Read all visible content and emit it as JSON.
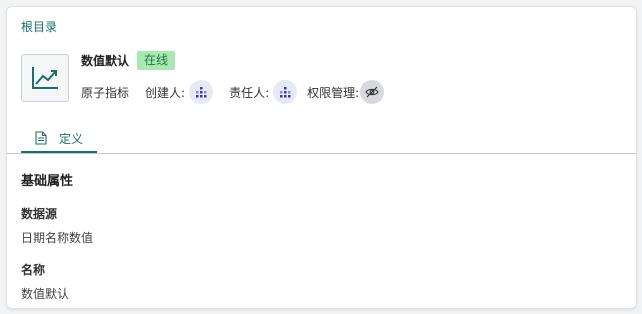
{
  "breadcrumb": {
    "label": "根目录"
  },
  "metric": {
    "icon": "trend-chart-icon",
    "name": "数值默认",
    "status": "在线",
    "type": "原子指标",
    "creator_label": "创建人:",
    "owner_label": "责任人:",
    "permission_label": "权限管理:"
  },
  "tabs": [
    {
      "label": "定义",
      "icon": "document-icon",
      "active": true
    }
  ],
  "definition": {
    "section_title": "基础属性",
    "fields": [
      {
        "label": "数据源",
        "value": "日期名称数值"
      },
      {
        "label": "名称",
        "value": "数值默认"
      }
    ]
  },
  "colors": {
    "accent": "#1b6f6a",
    "status_bg": "#a9e7b3",
    "status_text": "#1d7a36",
    "avatar": "#3b2ec7"
  }
}
